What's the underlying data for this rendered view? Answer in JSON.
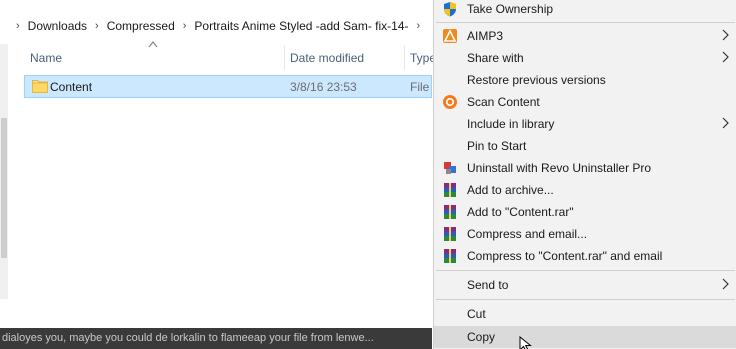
{
  "explorer": {
    "breadcrumb": [
      "Downloads",
      "Compressed",
      "Portraits Anime Styled -add Sam- fix-14-"
    ],
    "columns": {
      "name": "Name",
      "date": "Date modified",
      "type": "Type"
    },
    "rows": [
      {
        "name": "Content",
        "date": "3/8/16 23:53",
        "type": "File"
      }
    ],
    "bottom_text": "dialoyes you, maybe you could de lorkalin to flameeap your file from lenwe..."
  },
  "menu": {
    "items": [
      {
        "label": "Take Ownership",
        "icon": "shield-icon",
        "submenu": false
      },
      {
        "label": "AIMP3",
        "icon": "aimp-icon",
        "submenu": true
      },
      {
        "label": "Share with",
        "icon": "",
        "submenu": true
      },
      {
        "label": "Restore previous versions",
        "icon": "",
        "submenu": false
      },
      {
        "label": "Scan Content",
        "icon": "avast-scan-icon",
        "submenu": false
      },
      {
        "label": "Include in library",
        "icon": "",
        "submenu": true
      },
      {
        "label": "Pin to Start",
        "icon": "",
        "submenu": false
      },
      {
        "label": "Uninstall with Revo Uninstaller Pro",
        "icon": "revo-icon",
        "submenu": false
      },
      {
        "label": "Add to archive...",
        "icon": "winrar-icon",
        "submenu": false
      },
      {
        "label": "Add to \"Content.rar\"",
        "icon": "winrar-icon",
        "submenu": false
      },
      {
        "label": "Compress and email...",
        "icon": "winrar-icon",
        "submenu": false
      },
      {
        "label": "Compress to \"Content.rar\" and email",
        "icon": "winrar-icon",
        "submenu": false
      },
      {
        "label": "Send to",
        "icon": "",
        "submenu": true
      },
      {
        "label": "Cut",
        "icon": "",
        "submenu": false
      },
      {
        "label": "Copy",
        "icon": "",
        "submenu": false
      }
    ]
  },
  "colors": {
    "selection_bg": "#cce8ff",
    "selection_border": "#99d1ff",
    "menu_bg": "#f2f2f2",
    "hover_bg": "#dadada"
  }
}
